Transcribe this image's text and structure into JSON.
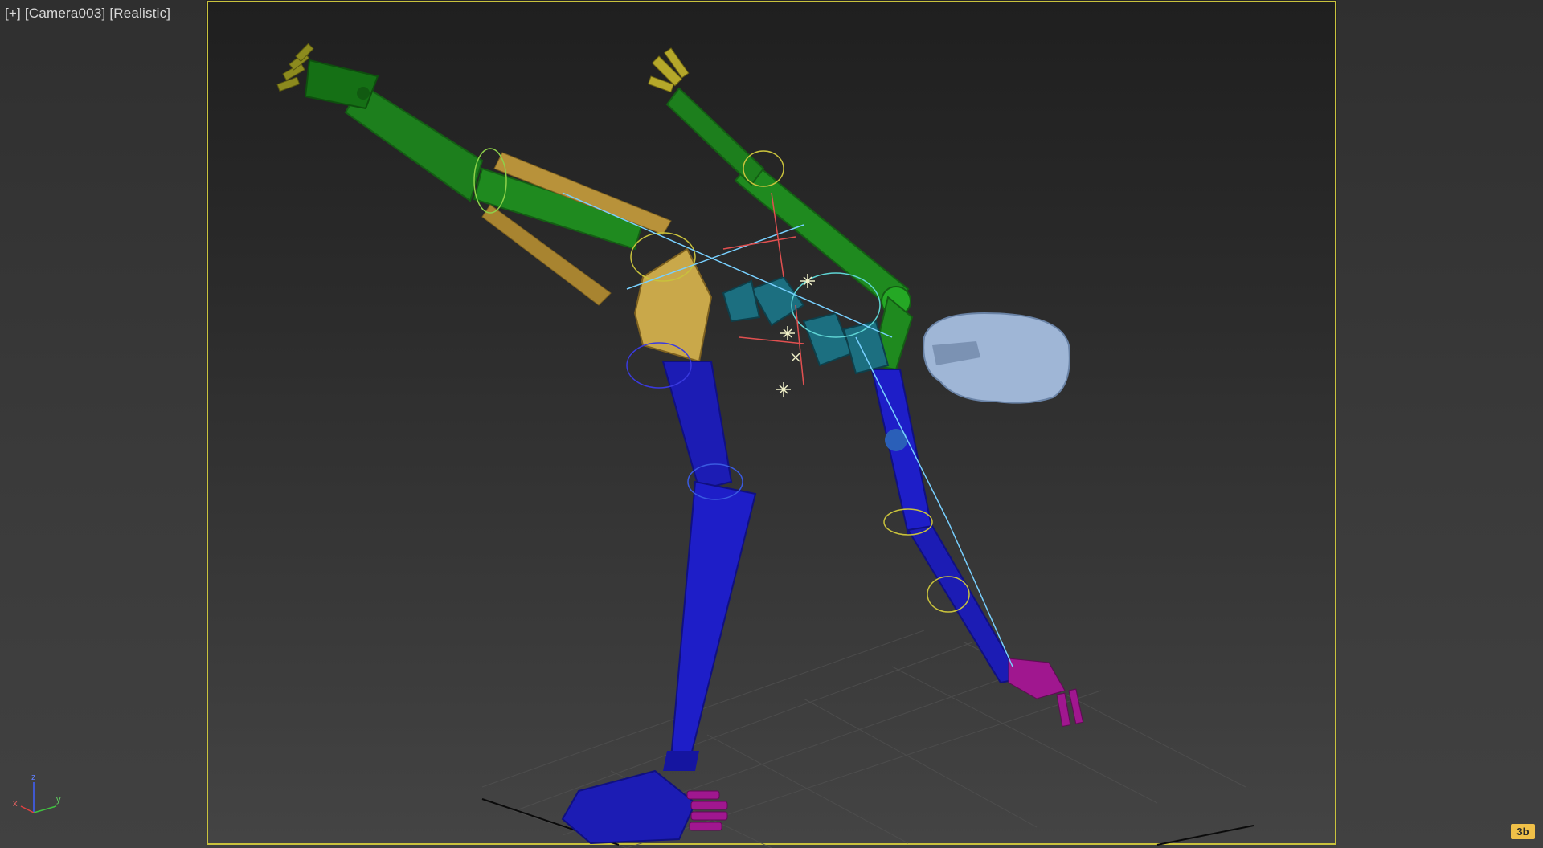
{
  "viewport": {
    "menu_label": "[+]",
    "camera_label": "[Camera003]",
    "shading_label": "[Realistic]"
  },
  "axis_tripod": {
    "x_label": "x",
    "y_label": "y",
    "z_label": "z"
  },
  "corner_badge": {
    "label": "3b"
  },
  "colors": {
    "safe_frame": "#c9c23c",
    "bone_green": "#1f8a1f",
    "bone_blue": "#1c1cb4",
    "bone_gold": "#c9a84a",
    "bone_magenta": "#a0178f",
    "head_gray_blue": "#9fb6d6",
    "teal": "#1c6f80"
  },
  "icons": {
    "axis": "axis-tripod-icon",
    "badge": "corner-badge-icon"
  }
}
